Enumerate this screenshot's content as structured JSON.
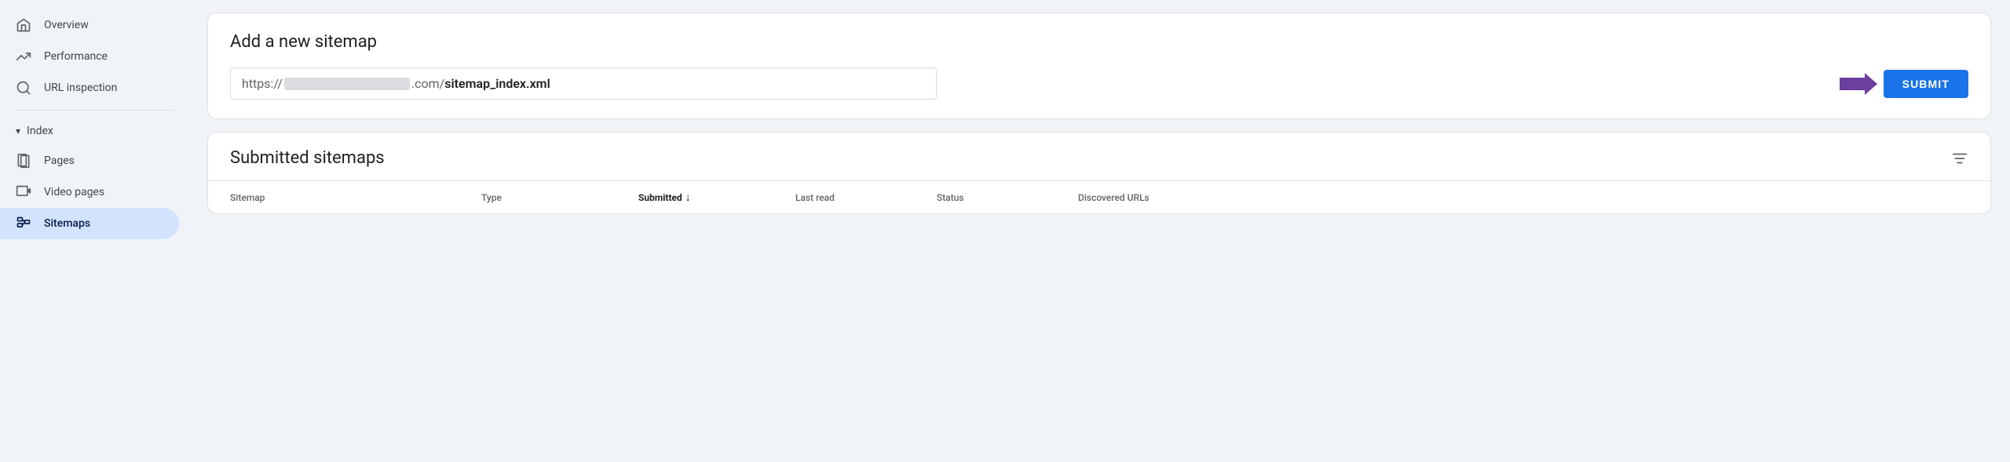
{
  "sidebar": {
    "items": [
      {
        "id": "overview",
        "label": "Overview",
        "icon": "home",
        "active": false
      },
      {
        "id": "performance",
        "label": "Performance",
        "icon": "trending-up",
        "active": false
      },
      {
        "id": "url-inspection",
        "label": "URL inspection",
        "icon": "search",
        "active": false
      }
    ],
    "section": {
      "label": "Index",
      "expanded": true,
      "children": [
        {
          "id": "pages",
          "label": "Pages",
          "icon": "pages",
          "active": false
        },
        {
          "id": "video-pages",
          "label": "Video pages",
          "icon": "video-pages",
          "active": false
        },
        {
          "id": "sitemaps",
          "label": "Sitemaps",
          "icon": "sitemaps",
          "active": true
        }
      ]
    }
  },
  "add_sitemap": {
    "title": "Add a new sitemap",
    "url_prefix": "https://",
    "url_domain_placeholder": "",
    "url_middle": ".com/",
    "url_suffix": "sitemap_index.xml",
    "submit_label": "SUBMIT"
  },
  "submitted_sitemaps": {
    "title": "Submitted sitemaps",
    "columns": {
      "sitemap": "Sitemap",
      "type": "Type",
      "submitted": "Submitted",
      "last_read": "Last read",
      "status": "Status",
      "discovered_urls": "Discovered URLs"
    }
  }
}
